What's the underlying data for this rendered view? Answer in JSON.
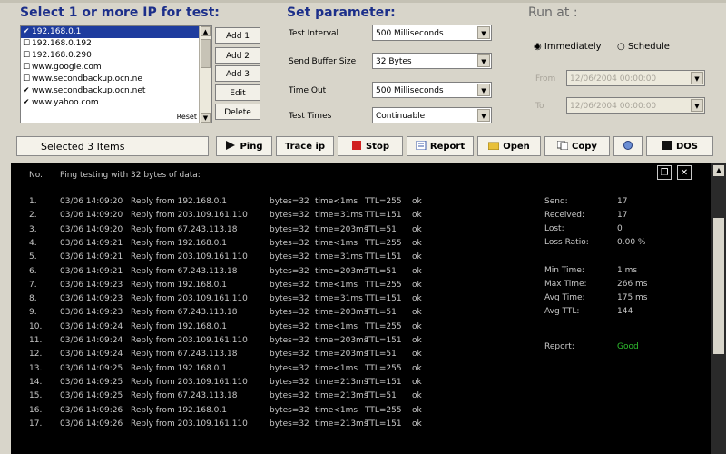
{
  "select_title": "Select 1 or more IP for test:",
  "param_title": "Set parameter:",
  "runat_title": "Run at :",
  "ip_list": [
    {
      "text": "192.168.0.1",
      "checked": true,
      "selected": true
    },
    {
      "text": "192.168.0.192",
      "checked": false,
      "selected": false
    },
    {
      "text": "192.168.0.290",
      "checked": false,
      "selected": false
    },
    {
      "text": "www.google.com",
      "checked": false,
      "selected": false
    },
    {
      "text": "www.secondbackup.ocn.ne",
      "checked": false,
      "selected": false
    },
    {
      "text": "www.secondbackup.ocn.net",
      "checked": true,
      "selected": false
    },
    {
      "text": "www.yahoo.com",
      "checked": true,
      "selected": false
    }
  ],
  "reset_label": "Reset",
  "side_buttons": [
    "Add 1",
    "Add 2",
    "Add 3",
    "Edit",
    "Delete"
  ],
  "params": [
    {
      "label": "Test Interval",
      "value": "500 Milliseconds"
    },
    {
      "label": "Send Buffer Size",
      "value": "32 Bytes"
    },
    {
      "label": "Time Out",
      "value": "500 Milliseconds"
    },
    {
      "label": "Test Times",
      "value": "Continuable"
    }
  ],
  "runat": {
    "immediately": "Immediately",
    "schedule": "Schedule",
    "from_label": "From",
    "to_label": "To",
    "from_value": "12/06/2004 00:00:00",
    "to_value": "12/06/2004 00:00:00"
  },
  "status_text": "Selected 3 Items",
  "toolbar": {
    "ping": "Ping",
    "trace": "Trace ip",
    "stop": "Stop",
    "report": "Report",
    "open": "Open",
    "copy": "Copy",
    "dos": "DOS"
  },
  "console": {
    "col_no": "No.",
    "header": "Ping testing with 32 bytes of data:",
    "rows": [
      {
        "no": "1.",
        "time": "03/06 14:09:20",
        "reply": "Reply from 192.168.0.1",
        "bytes": "bytes=32",
        "t": "time<1ms",
        "ttl": "TTL=255",
        "res": "ok"
      },
      {
        "no": "2.",
        "time": "03/06 14:09:20",
        "reply": "Reply from 203.109.161.110",
        "bytes": "bytes=32",
        "t": "time=31ms",
        "ttl": "TTL=151",
        "res": "ok"
      },
      {
        "no": "3.",
        "time": "03/06 14:09:20",
        "reply": "Reply from 67.243.113.18",
        "bytes": "bytes=32",
        "t": "time=203ms",
        "ttl": "TTL=51",
        "res": "ok"
      },
      {
        "no": "4.",
        "time": "03/06 14:09:21",
        "reply": "Reply from 192.168.0.1",
        "bytes": "bytes=32",
        "t": "time<1ms",
        "ttl": "TTL=255",
        "res": "ok"
      },
      {
        "no": "5.",
        "time": "03/06 14:09:21",
        "reply": "Reply from 203.109.161.110",
        "bytes": "bytes=32",
        "t": "time=31ms",
        "ttl": "TTL=151",
        "res": "ok"
      },
      {
        "no": "6.",
        "time": "03/06 14:09:21",
        "reply": "Reply from 67.243.113.18",
        "bytes": "bytes=32",
        "t": "time=203ms",
        "ttl": "TTL=51",
        "res": "ok"
      },
      {
        "no": "7.",
        "time": "03/06 14:09:23",
        "reply": "Reply from 192.168.0.1",
        "bytes": "bytes=32",
        "t": "time<1ms",
        "ttl": "TTL=255",
        "res": "ok"
      },
      {
        "no": "8.",
        "time": "03/06 14:09:23",
        "reply": "Reply from 203.109.161.110",
        "bytes": "bytes=32",
        "t": "time=31ms",
        "ttl": "TTL=151",
        "res": "ok"
      },
      {
        "no": "9.",
        "time": "03/06 14:09:23",
        "reply": "Reply from 67.243.113.18",
        "bytes": "bytes=32",
        "t": "time=203ms",
        "ttl": "TTL=51",
        "res": "ok"
      },
      {
        "no": "10.",
        "time": "03/06 14:09:24",
        "reply": "Reply from 192.168.0.1",
        "bytes": "bytes=32",
        "t": "time<1ms",
        "ttl": "TTL=255",
        "res": "ok"
      },
      {
        "no": "11.",
        "time": "03/06 14:09:24",
        "reply": "Reply from 203.109.161.110",
        "bytes": "bytes=32",
        "t": "time=203ms",
        "ttl": "TTL=151",
        "res": "ok"
      },
      {
        "no": "12.",
        "time": "03/06 14:09:24",
        "reply": "Reply from 67.243.113.18",
        "bytes": "bytes=32",
        "t": "time=203ms",
        "ttl": "TTL=51",
        "res": "ok"
      },
      {
        "no": "13.",
        "time": "03/06 14:09:25",
        "reply": "Reply from 192.168.0.1",
        "bytes": "bytes=32",
        "t": "time<1ms",
        "ttl": "TTL=255",
        "res": "ok"
      },
      {
        "no": "14.",
        "time": "03/06 14:09:25",
        "reply": "Reply from 203.109.161.110",
        "bytes": "bytes=32",
        "t": "time=213ms",
        "ttl": "TTL=151",
        "res": "ok"
      },
      {
        "no": "15.",
        "time": "03/06 14:09:25",
        "reply": "Reply from 67.243.113.18",
        "bytes": "bytes=32",
        "t": "time=213ms",
        "ttl": "TTL=51",
        "res": "ok"
      },
      {
        "no": "16.",
        "time": "03/06 14:09:26",
        "reply": "Reply from 192.168.0.1",
        "bytes": "bytes=32",
        "t": "time<1ms",
        "ttl": "TTL=255",
        "res": "ok"
      },
      {
        "no": "17.",
        "time": "03/06 14:09:26",
        "reply": "Reply from 203.109.161.110",
        "bytes": "bytes=32",
        "t": "time=213ms",
        "ttl": "TTL=151",
        "res": "ok"
      }
    ],
    "stats": [
      {
        "label": "Send:",
        "value": "17"
      },
      {
        "label": "Received:",
        "value": "17"
      },
      {
        "label": "Lost:",
        "value": "0"
      },
      {
        "label": "Loss Ratio:",
        "value": "0.00 %"
      },
      {
        "label": "Min Time:",
        "value": "1 ms"
      },
      {
        "label": "Max Time:",
        "value": "266 ms"
      },
      {
        "label": "Avg Time:",
        "value": "175 ms"
      },
      {
        "label": "Avg TTL:",
        "value": "144"
      }
    ],
    "report_label": "Report:",
    "report_value": "Good",
    "report_color": "#2fbf2f"
  }
}
